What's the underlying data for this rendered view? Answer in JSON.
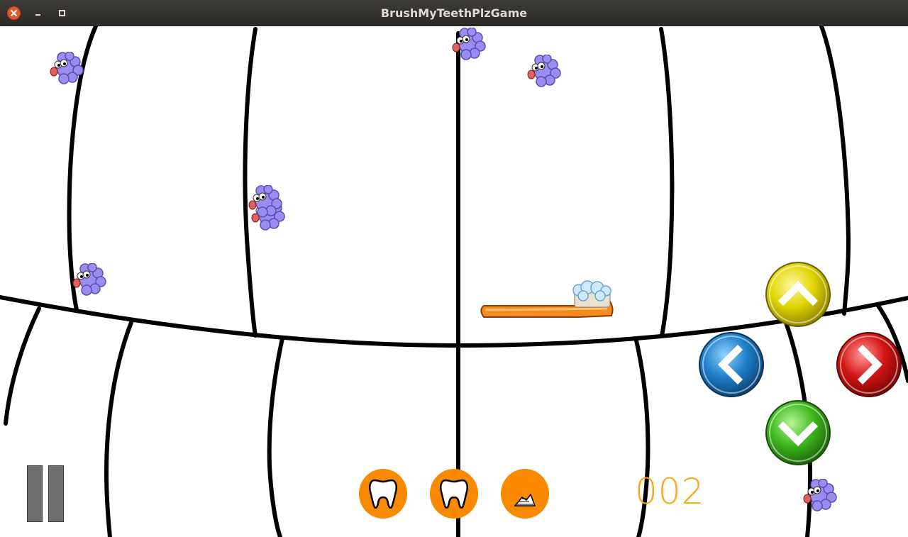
{
  "window": {
    "title": "BrushMyTeethPlzGame",
    "controls": [
      "close",
      "minimize",
      "maximize"
    ]
  },
  "game": {
    "score": "002",
    "tools": [
      {
        "icon": "tooth-icon"
      },
      {
        "icon": "tooth-icon"
      },
      {
        "icon": "toothpaste-icon"
      }
    ],
    "direction_buttons": {
      "up": {
        "icon": "chevron-up-icon",
        "color": "#e0d400"
      },
      "left": {
        "icon": "chevron-left-icon",
        "color": "#1e7fc8"
      },
      "right": {
        "icon": "chevron-right-icon",
        "color": "#d41414"
      },
      "down": {
        "icon": "chevron-down-icon",
        "color": "#3cb81c"
      }
    },
    "germ_count": 7,
    "colors": {
      "germ": "#9b8cf2",
      "brush": "#f68a1e",
      "tool_button": "#f98a00",
      "score": "#f9a818"
    }
  }
}
